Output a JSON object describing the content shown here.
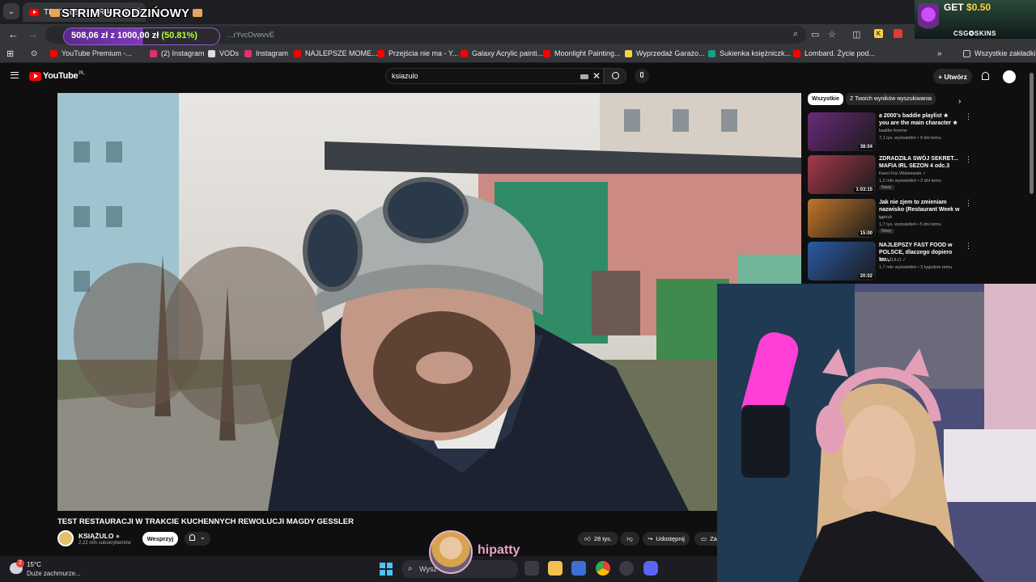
{
  "browser": {
    "active_tab_title": "TEST RESTAURACJI W TRA",
    "omnibox_fragment": "...rYvcOvwvvE",
    "bookmarks": [
      {
        "label": "YouTube Premium -...",
        "color": "#ff0000"
      },
      {
        "label": "(2) Instagram",
        "color": "#e1306c"
      },
      {
        "label": "VODs",
        "color": "#dddddd"
      },
      {
        "label": "Instagram",
        "color": "#e1306c"
      },
      {
        "label": "NAJLEPSZE MOME...",
        "color": "#ff0000"
      },
      {
        "label": "Przejścia nie ma - Y...",
        "color": "#ff0000"
      },
      {
        "label": "Galaxy Acrylic painti...",
        "color": "#ff0000"
      },
      {
        "label": "Moonlight Painting...",
        "color": "#ff0000"
      },
      {
        "label": "Wyprzedaż Garażo...",
        "color": "#f7d046"
      },
      {
        "label": "Sukienka księżniczk...",
        "color": "#16a085"
      },
      {
        "label": "Lombard. Życie pod...",
        "color": "#ff0000"
      }
    ],
    "all_bookmarks_label": "Wszystkie zakładki"
  },
  "stream_overlay": {
    "title": "STRIM URODZIŃOWY",
    "goal_current": "508,06 zł",
    "goal_sep": " z ",
    "goal_target": "1000,00 zł",
    "goal_percent": " (50.81%)",
    "goal_progress": 0.5081,
    "viewer_name": "hipatty"
  },
  "ad": {
    "get_label": "GET",
    "amount": "$0.50",
    "brand": "CSG✪SKINS"
  },
  "youtube": {
    "logo_text": "YouTube",
    "country": "PL",
    "search_value": "ksiazulo",
    "create_label": "Utwórz",
    "video": {
      "title": "TEST RESTAURACJI W TRAKCIE KUCHENNYCH REWOLUCJI MAGDY GESSLER",
      "channel_name": "KSIĄŻULO",
      "channel_subs": "2,22 mln subskrybentów",
      "support_label": "Wesprzyj",
      "likes": "28 tys.",
      "share_label": "Udostępnij",
      "save_label": "Za"
    },
    "chips": [
      "Wszystkie",
      "Z Twoich wyników wyszukiwania"
    ],
    "recommendations": [
      {
        "title": "a 2000's baddie playlist ★ you are the main character ★",
        "channel": "baddie femme",
        "meta": "7,1 tys. wyświetleń • 9 dni temu",
        "duration": "38:04",
        "is_new": "",
        "thumb": "#6a2a7a"
      },
      {
        "title": "ZDRADZIŁA SWÓJ SEKRET... MAFIA IRL SEZON 4 odc.3",
        "channel": "Karol Friz Wiśniewski ✓",
        "meta": "1,2 mln wyświetleń • 2 dni temu",
        "duration": "1:03:15",
        "is_new": "Nowy",
        "thumb": "#a53a4a"
      },
      {
        "title": "Jak nie zjem to zmieniam nazwisko (Restaurant Week w ...",
        "channel": "typtryk",
        "meta": "1,7 tys. wyświetleń • 5 dni temu",
        "duration": "15:00",
        "is_new": "Nowy",
        "thumb": "#c2762a"
      },
      {
        "title": "NAJLEPSZY FAST FOOD w POLSCE, dlaczego dopiero ter...",
        "channel": "KSIĄŻULO ✓",
        "meta": "1,7 mln wyświetleń • 3 tygodnie temu",
        "duration": "20:02",
        "is_new": "",
        "thumb": "#2a5aa5"
      }
    ]
  },
  "taskbar": {
    "temperature": "15°C",
    "weather": "Duże zachmurze...",
    "weather_badge": "2",
    "search_placeholder": "Wysz"
  }
}
